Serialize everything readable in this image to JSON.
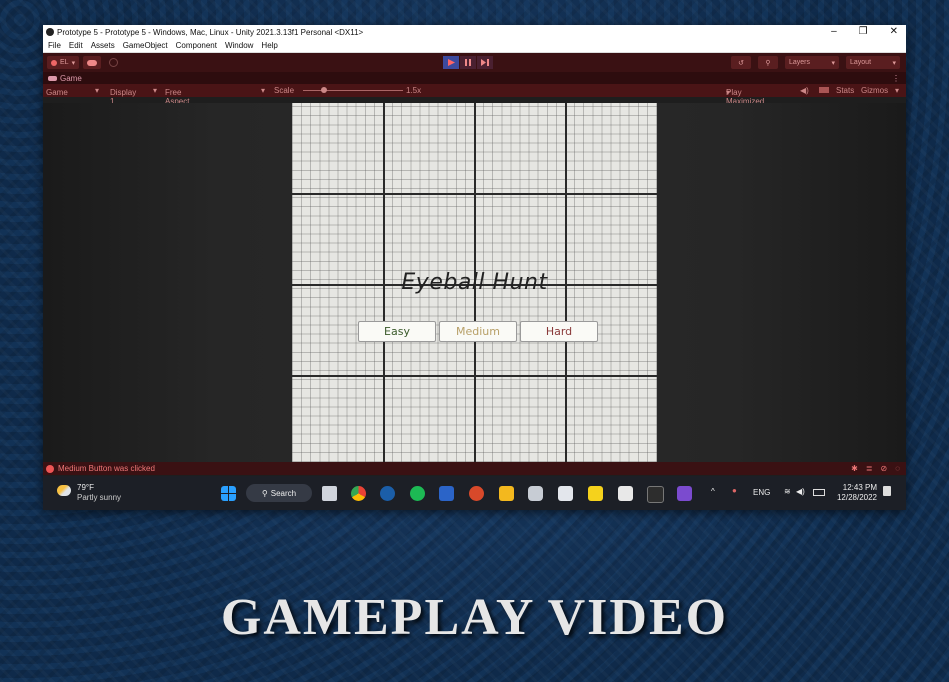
{
  "window": {
    "title": "Prototype 5 - Prototype 5 - Windows, Mac, Linux - Unity 2021.3.13f1 Personal <DX11>",
    "controls": [
      "–",
      "❐",
      "✕"
    ]
  },
  "menu": [
    "File",
    "Edit",
    "Assets",
    "GameObject",
    "Component",
    "Window",
    "Help"
  ],
  "toolbar": {
    "account_label": "EL",
    "layers_label": "Layers",
    "layout_label": "Layout"
  },
  "tab": {
    "label": "Game"
  },
  "gamebar": {
    "mode": "Game",
    "display": "Display 1",
    "aspect": "Free Aspect",
    "scale_label": "Scale",
    "scale_value": "1.5x",
    "play_mode": "Play Maximized",
    "stats": "Stats",
    "gizmos": "Gizmos"
  },
  "game": {
    "title": "Eyeball Hunt",
    "buttons": [
      {
        "label": "Easy",
        "color": "#3a5a2a"
      },
      {
        "label": "Medium",
        "color": "#b8a068"
      },
      {
        "label": "Hard",
        "color": "#8a3a3a"
      }
    ]
  },
  "status": {
    "message": "Medium Button was clicked"
  },
  "taskbar": {
    "weather_temp": "79°F",
    "weather_desc": "Partly sunny",
    "search_label": "Search",
    "language": "ENG",
    "time": "12:43 PM",
    "date": "12/28/2022"
  },
  "caption": "GAMEPLAY VIDEO",
  "colors": {
    "unity_toolbar": "#3a1113",
    "play_active": "#3c4a9e",
    "slide_bg": "#0f2a4a"
  }
}
